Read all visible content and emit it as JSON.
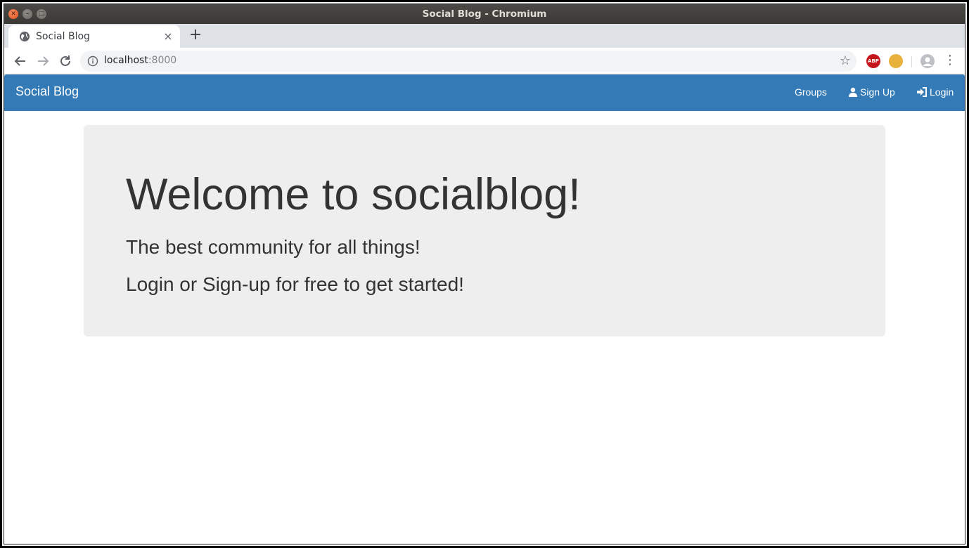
{
  "window": {
    "title": "Social Blog - Chromium"
  },
  "browser": {
    "tab": {
      "title": "Social Blog",
      "close_glyph": "×"
    },
    "new_tab_glyph": "+",
    "address": {
      "host": "localhost",
      "port": ":8000"
    },
    "extensions": {
      "abp_label": "ABP"
    }
  },
  "navbar": {
    "brand": "Social Blog",
    "links": {
      "groups": "Groups",
      "signup": "Sign Up",
      "login": "Login"
    },
    "color": "#337ab7"
  },
  "jumbotron": {
    "heading": "Welcome to socialblog!",
    "lead_1": "The best community for all things!",
    "lead_2": "Login or Sign-up for free to get started!"
  },
  "icons": {
    "window_close": "close-icon",
    "window_minimize": "minimize-icon",
    "window_maximize": "maximize-icon",
    "tab_favicon": "globe-icon",
    "back": "arrow-left-icon",
    "forward": "arrow-right-icon",
    "reload": "reload-icon",
    "site_info": "info-icon",
    "bookmark": "star-icon",
    "profile": "user-avatar-icon",
    "menu": "kebab-menu-icon",
    "signup": "user-icon",
    "login": "log-in-icon"
  }
}
